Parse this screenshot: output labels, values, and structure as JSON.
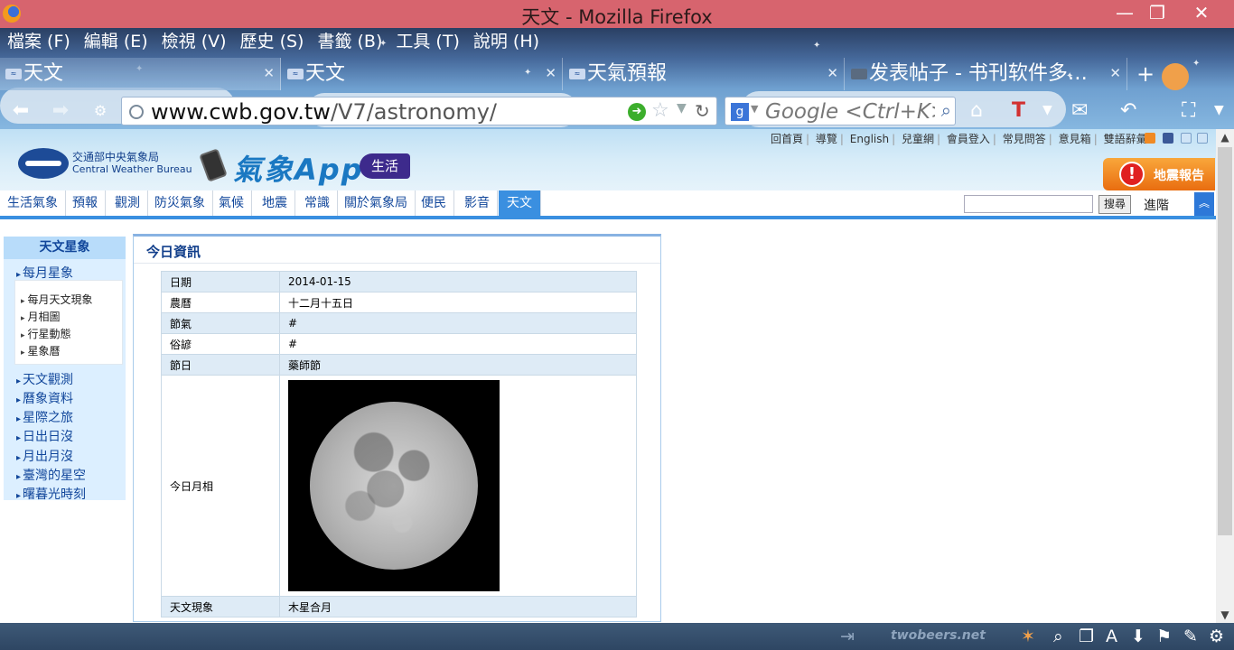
{
  "window": {
    "title": "天文 - Mozilla Firefox",
    "min": "—",
    "max": "❐",
    "close": "✕"
  },
  "menu": [
    "檔案 (F)",
    "編輯 (E)",
    "檢視 (V)",
    "歷史 (S)",
    "書籤 (B)",
    "工具 (T)",
    "說明 (H)"
  ],
  "tabs": [
    {
      "label": "天文",
      "favicon": "cwb-favicon"
    },
    {
      "label": "天文",
      "favicon": "cwb-favicon"
    },
    {
      "label": "天氣預報",
      "favicon": "cwb-favicon"
    },
    {
      "label": "发表帖子 - 书刊软件多…",
      "favicon": "forum-favicon"
    }
  ],
  "tab_close": "✕",
  "newtab": "+",
  "nav": {
    "url_host": "www.cwb.gov.tw",
    "url_path": "/V7/astronomy/",
    "search_placeholder": "Google <Ctrl+K>",
    "search_engine": "g"
  },
  "header": {
    "agency_zh": "交通部中央氣象局",
    "agency_en": "Central Weather Bureau",
    "app_name": "氣象App",
    "app_tag": "生活",
    "quake_label": "地震報告",
    "top_links": [
      "回首頁",
      "導覽",
      "English",
      "兒童網",
      "會員登入",
      "常見問答",
      "意見箱",
      "雙語辭彙"
    ]
  },
  "mainnav": {
    "items": [
      "生活氣象",
      "預報",
      "觀測",
      "防災氣象",
      "氣候",
      "地震",
      "常識",
      "關於氣象局",
      "便民",
      "影音",
      "天文"
    ],
    "active": "天文",
    "search_button": "搜尋",
    "advanced": "進階"
  },
  "sidebar": {
    "heading": "天文星象",
    "section1": "每月星象",
    "sub_items": [
      "每月天文現象",
      "月相圖",
      "行星動態",
      "星象曆"
    ],
    "items": [
      "天文觀測",
      "曆象資料",
      "星際之旅",
      "日出日沒",
      "月出月沒",
      "臺灣的星空",
      "曙暮光時刻"
    ]
  },
  "panel": {
    "title": "今日資訊",
    "rows": [
      {
        "key": "日期",
        "value": "2014-01-15"
      },
      {
        "key": "農曆",
        "value": "十二月十五日"
      },
      {
        "key": "節氣",
        "value": "#"
      },
      {
        "key": "俗諺",
        "value": "#"
      },
      {
        "key": "節日",
        "value": "藥師節"
      }
    ],
    "moon_key": "今日月相",
    "last_row": {
      "key": "天文現象",
      "value": "木星合月"
    }
  },
  "addonbar": {
    "brand": "twobeers.net"
  }
}
